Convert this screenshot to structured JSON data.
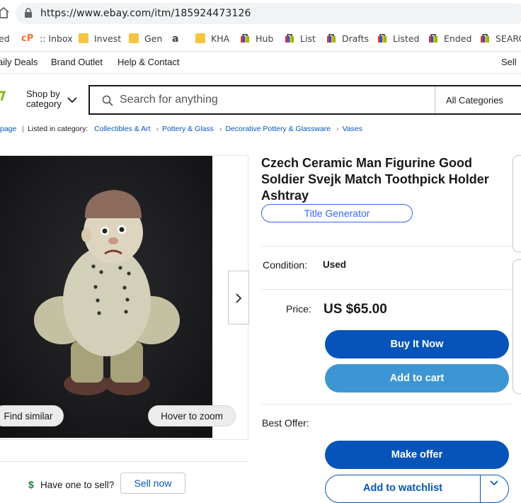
{
  "browser": {
    "url": "https://www.ebay.com/itm/185924473126",
    "bookmarks": [
      {
        "label": "ed",
        "icon": "generic-icon"
      },
      {
        "label": ":: Inbox",
        "icon": "cpanel-icon"
      },
      {
        "label": "Invest",
        "icon": "folder-icon"
      },
      {
        "label": "Gen",
        "icon": "folder-icon"
      },
      {
        "label": "",
        "icon": "amazon-icon"
      },
      {
        "label": "KHA",
        "icon": "folder-icon"
      },
      {
        "label": "Hub",
        "icon": "ebay-bag-icon"
      },
      {
        "label": "List",
        "icon": "ebay-bag-icon"
      },
      {
        "label": "Drafts",
        "icon": "ebay-bag-icon"
      },
      {
        "label": "Listed",
        "icon": "ebay-bag-icon"
      },
      {
        "label": "Ended",
        "icon": "ebay-bag-icon"
      },
      {
        "label": "SEARC",
        "icon": "ebay-bag-icon"
      }
    ]
  },
  "topnav": {
    "daily_deals": "aily Deals",
    "brand_outlet": "Brand Outlet",
    "help_contact": "Help & Contact",
    "sell": "Sell"
  },
  "header": {
    "shop_by_category_line1": "Shop by",
    "shop_by_category_line2": "category",
    "search_placeholder": "Search for anything",
    "category_select": "All Categories"
  },
  "breadcrumb": {
    "back": "page",
    "listed_in": "Listed in category:",
    "items": [
      "Collectibles & Art",
      "Pottery & Glass",
      "Decorative Pottery & Glassware",
      "Vases"
    ]
  },
  "gallery": {
    "find_similar": "Find similar",
    "hover_zoom": "Hover to zoom"
  },
  "listing": {
    "title": "Czech Ceramic Man Figurine Good Soldier Svejk Match Toothpick Holder Ashtray",
    "title_generator": "Title Generator",
    "condition_label": "Condition:",
    "condition_value": "Used",
    "price_label": "Price:",
    "price_value": "US $65.00",
    "buy_now": "Buy It Now",
    "add_to_cart": "Add to cart",
    "best_offer_label": "Best Offer:",
    "make_offer": "Make offer",
    "add_to_watchlist": "Add to watchlist"
  },
  "sell_banner": {
    "have_one": "Have one to sell?",
    "sell_now": "Sell now"
  },
  "colors": {
    "primary_button": "#0654ba",
    "secondary_button": "#3d96d3",
    "link": "#0654ba"
  }
}
